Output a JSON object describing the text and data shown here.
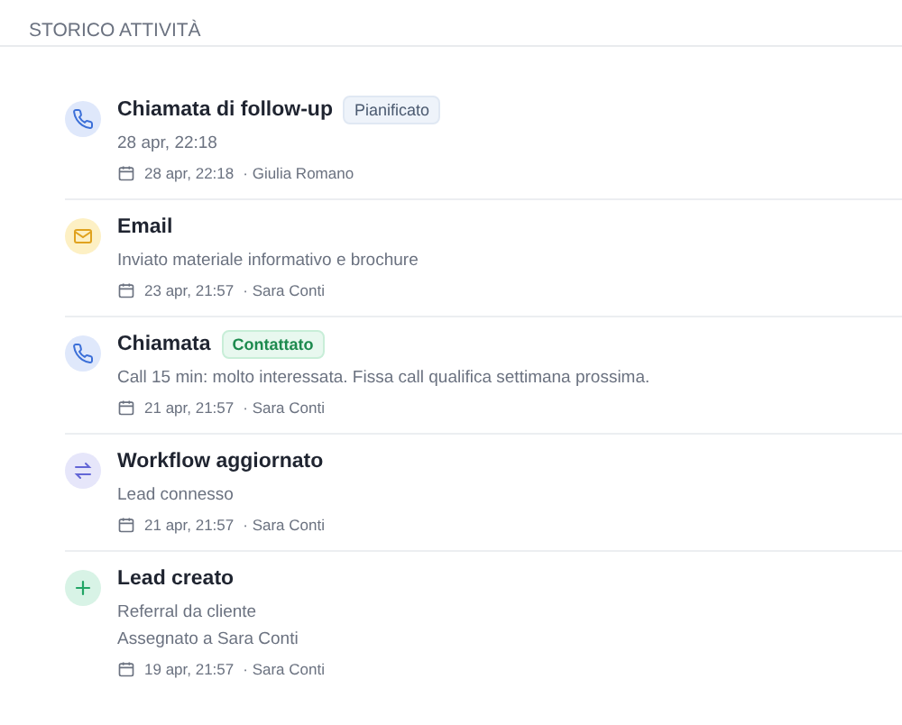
{
  "section_title": "STORICO ATTIVITÀ",
  "activities": [
    {
      "kind": "call",
      "title": "Chiamata di follow-up",
      "badge": {
        "label": "Pianificato",
        "kind": "planned"
      },
      "lines": [
        "28 apr, 22:18"
      ],
      "date": "28 apr, 22:18",
      "author": "· Giulia Romano"
    },
    {
      "kind": "email",
      "title": "Email",
      "lines": [
        "Inviato materiale informativo e brochure"
      ],
      "date": "23 apr, 21:57",
      "author": "· Sara Conti"
    },
    {
      "kind": "call",
      "title": "Chiamata",
      "badge": {
        "label": "Contattato",
        "kind": "contacted"
      },
      "lines": [
        "Call 15 min: molto interessata. Fissa call qualifica settimana prossima."
      ],
      "date": "21 apr, 21:57",
      "author": "· Sara Conti"
    },
    {
      "kind": "workflow",
      "title": "Workflow aggiornato",
      "lines": [
        "Lead connesso"
      ],
      "date": "21 apr, 21:57",
      "author": "· Sara Conti"
    },
    {
      "kind": "create",
      "title": "Lead creato",
      "lines": [
        "Referral da cliente",
        "Assegnato a Sara Conti"
      ],
      "date": "19 apr, 21:57",
      "author": "· Sara Conti"
    }
  ]
}
